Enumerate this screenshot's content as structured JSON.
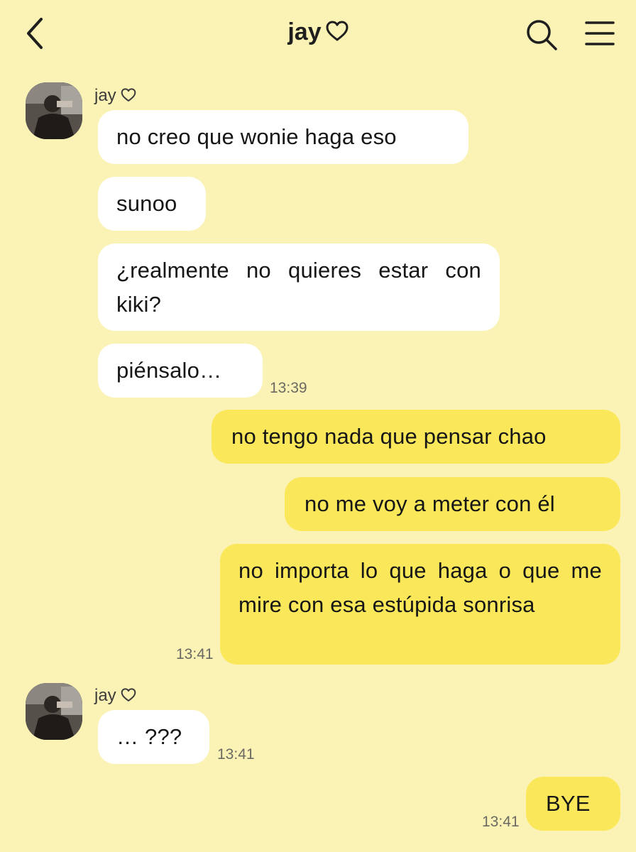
{
  "header": {
    "title": "jay",
    "back_icon": "chevron-left-icon",
    "title_icon": "heart-outline-icon",
    "search_icon": "search-icon",
    "menu_icon": "hamburger-menu-icon"
  },
  "colors": {
    "background": "#fbf2b5",
    "incoming_bubble": "#ffffff",
    "outgoing_bubble": "#fbe85a"
  },
  "messages": {
    "group1": {
      "sender": "jay",
      "avatar_icon": "avatar-photo",
      "m1": "no creo que wonie haga eso",
      "m2": "sunoo",
      "m3": "¿realmente no quieres estar con kiki?",
      "m4": "piénsalo…",
      "time": "13:39"
    },
    "group2": {
      "m1": "no tengo nada que pensar chao",
      "m2": "no me voy a meter con él",
      "m3": "no importa lo que haga o que me mire con esa estúpida sonrisa",
      "time": "13:41"
    },
    "group3": {
      "sender": "jay",
      "avatar_icon": "avatar-photo",
      "m1": "… ???",
      "time": "13:41"
    },
    "group4": {
      "m1": "BYE",
      "time": "13:41"
    }
  }
}
